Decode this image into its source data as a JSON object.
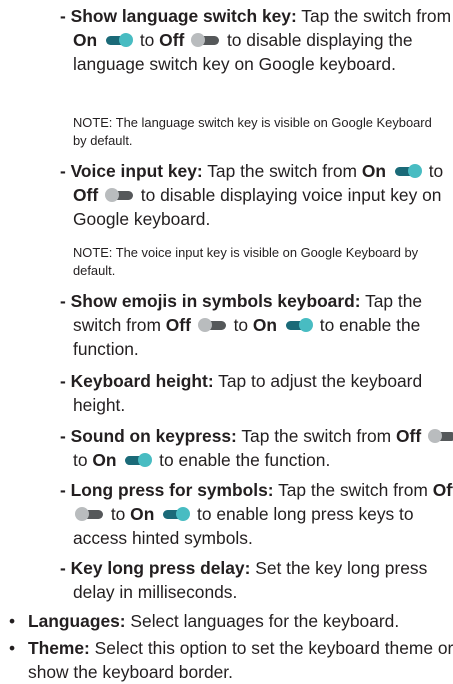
{
  "sub_items": [
    {
      "title": "- Show language switch key:",
      "segments": [
        " Tap the switch from ",
        "On",
        " ",
        " to ",
        "Off",
        " ",
        " to disable displaying the language switch key on Google keyboard."
      ],
      "note": "NOTE: The language switch key is visible on Google Keyboard by default."
    },
    {
      "title": "- Voice input key:",
      "segments": [
        " Tap the switch from ",
        "On",
        " ",
        " to ",
        "Off",
        " ",
        " to disable displaying voice input key on Google keyboard."
      ],
      "note": "NOTE: The voice input key is visible on Google Keyboard by default."
    },
    {
      "title": "- Show emojis in symbols keyboard:",
      "segments": [
        " Tap the switch from ",
        "Off",
        " ",
        " to ",
        "On",
        " ",
        " to enable the function."
      ]
    },
    {
      "title": "- Keyboard height:",
      "text": " Tap to adjust the keyboard height."
    },
    {
      "title": "- Sound on keypress:",
      "segments": [
        " Tap the switch from ",
        "Off",
        " ",
        " to ",
        "On",
        " ",
        " to enable the function."
      ]
    },
    {
      "title": "- Long press for symbols:",
      "segments": [
        " Tap the switch from ",
        "Off",
        " ",
        " to ",
        "On",
        " ",
        " to enable long press keys to access hinted symbols."
      ]
    },
    {
      "title": "- Key long press delay:",
      "text": " Set the key long press delay in milliseconds."
    }
  ],
  "bullets": [
    {
      "marker": "•",
      "title": "Languages:",
      "text": " Select languages for the keyboard."
    },
    {
      "marker": "•",
      "title": "Theme:",
      "text": " Select this option to set the keyboard theme or show the keyboard border."
    }
  ],
  "colors": {
    "toggle_on_knob": "#48bcc2",
    "toggle_on_track": "#1b6a78",
    "toggle_off_knob": "#b9bcbe",
    "toggle_off_track": "#55585a"
  }
}
